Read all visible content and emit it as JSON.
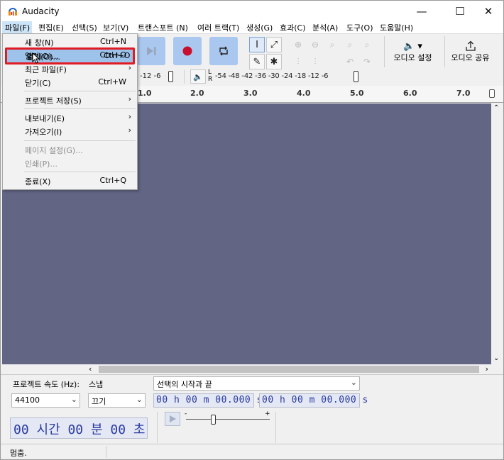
{
  "window": {
    "title": "Audacity",
    "minimize_icon": "minimize-icon",
    "maximize_icon": "maximize-icon",
    "close_icon": "close-icon"
  },
  "menubar": {
    "items": [
      "파일(F)",
      "편집(E)",
      "선택(S)",
      "보기(V)",
      "트랜스포트 (N)",
      "여러 트랙(T)",
      "생성(G)",
      "효과(C)",
      "분석(A)",
      "도구(O)",
      "도움말(H)"
    ]
  },
  "file_menu": {
    "items": [
      {
        "label": "새 창(N)",
        "shortcut": "Ctrl+N"
      },
      {
        "label": "열기(O)...",
        "shortcut": "Ctrl+O"
      },
      {
        "label": "최근 파일(F)",
        "shortcut": ""
      },
      {
        "label": "닫기(C)",
        "shortcut": "Ctrl+W"
      },
      {
        "label": "프로젝트 저장(S)",
        "shortcut": ""
      },
      {
        "label": "내보내기(E)",
        "shortcut": ""
      },
      {
        "label": "가져오기(I)",
        "shortcut": ""
      },
      {
        "label": "페이지 설정(G)...",
        "shortcut": ""
      },
      {
        "label": "인쇄(P)...",
        "shortcut": ""
      },
      {
        "label": "종료(X)",
        "shortcut": "Ctrl+Q"
      }
    ],
    "submenu_arrow": "›"
  },
  "toolbar": {
    "audio_setup_label": "오디오 설정",
    "audio_share_label": "오디오 공유",
    "speaker_glyph": "🔊",
    "share_glyph": "⇪"
  },
  "meters": {
    "record_scale": "-12  -6",
    "play_scale": "-54  -48  -42  -36  -30  -24  -18  -12  -6",
    "lr_l": "L",
    "lr_r": "R"
  },
  "ruler": {
    "ticks": [
      "1.0",
      "2.0",
      "3.0",
      "4.0",
      "5.0",
      "6.0",
      "7.0"
    ]
  },
  "bottom": {
    "rate_label": "프로젝트 속도 (Hz):",
    "snap_label": "스냅",
    "selection_label": "선택의 시작과 끝",
    "rate_value": "44100",
    "snap_value": "끄기",
    "sel_start": "00 h 00 m 00.000 s",
    "sel_end": "00 h 00 m 00.000 s",
    "time_display": "00 시간 00 분 00 초"
  },
  "status": {
    "text": "멈춤."
  },
  "colors": {
    "accent": "#a9c7ef",
    "track_bg": "#636584",
    "highlight": "#e01b24",
    "record": "#c8102e"
  }
}
